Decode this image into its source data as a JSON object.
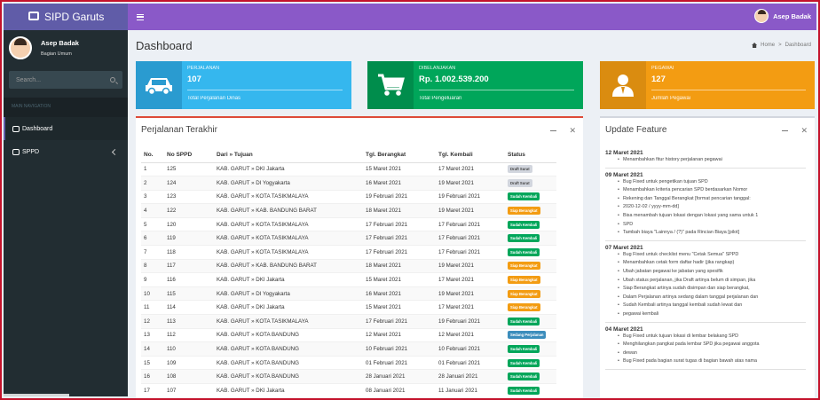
{
  "app": {
    "title": "SIPD Garuts"
  },
  "navbar": {
    "user_name": "Asep Badak"
  },
  "sidebar": {
    "user_name": "Asep Badak",
    "user_role": "Bagian Umum",
    "search_placeholder": "Search...",
    "header": "MAIN NAVIGATION",
    "items": [
      {
        "label": "Dashboard",
        "icon": "dashboard-icon"
      },
      {
        "label": "SPPD",
        "icon": "bus-icon"
      }
    ]
  },
  "page": {
    "title": "Dashboard",
    "breadcrumb": [
      "Home",
      "Dashboard"
    ]
  },
  "info_boxes": [
    {
      "label": "PERJALANAN",
      "value": "107",
      "desc": "Total Perjalanan Dinas",
      "icon": "car-icon",
      "color": "#35b7ee"
    },
    {
      "label": "DIBELANJAKAN",
      "value": "Rp. 1.002.539.200",
      "desc": "Total Pengeluaran",
      "icon": "cart-icon",
      "color": "#00a65a"
    },
    {
      "label": "PEGAWAI",
      "value": "127",
      "desc": "Jumlah Pegawai",
      "icon": "user-icon",
      "color": "#f39c12"
    }
  ],
  "trips": {
    "title": "Perjalanan Terakhir",
    "columns": [
      "No.",
      "No SPPD",
      "Dari » Tujuan",
      "Tgl. Berangkat",
      "Tgl. Kembali",
      "Status"
    ],
    "rows": [
      [
        "1",
        "125",
        "KAB. GARUT » DKI Jakarta",
        "15 Maret 2021",
        "17 Maret 2021",
        "Draft Surat",
        "draft"
      ],
      [
        "2",
        "124",
        "KAB. GARUT » DI Yogyakarta",
        "16 Maret 2021",
        "19 Maret 2021",
        "Draft Surat",
        "draft"
      ],
      [
        "3",
        "123",
        "KAB. GARUT » KOTA TASIKMALAYA",
        "19 Februari 2021",
        "19 Februari 2021",
        "Sudah Kembali",
        "sudah"
      ],
      [
        "4",
        "122",
        "KAB. GARUT » KAB. BANDUNG BARAT",
        "18 Maret 2021",
        "19 Maret 2021",
        "Siap Berangkat",
        "siap"
      ],
      [
        "5",
        "120",
        "KAB. GARUT » KOTA TASIKMALAYA",
        "17 Februari 2021",
        "17 Februari 2021",
        "Sudah Kembali",
        "sudah"
      ],
      [
        "6",
        "119",
        "KAB. GARUT » KOTA TASIKMALAYA",
        "17 Februari 2021",
        "17 Februari 2021",
        "Sudah Kembali",
        "sudah"
      ],
      [
        "7",
        "118",
        "KAB. GARUT » KOTA TASIKMALAYA",
        "17 Februari 2021",
        "17 Februari 2021",
        "Sudah Kembali",
        "sudah"
      ],
      [
        "8",
        "117",
        "KAB. GARUT » KAB. BANDUNG BARAT",
        "18 Maret 2021",
        "19 Maret 2021",
        "Siap Berangkat",
        "siap"
      ],
      [
        "9",
        "116",
        "KAB. GARUT » DKI Jakarta",
        "15 Maret 2021",
        "17 Maret 2021",
        "Siap Berangkat",
        "siap"
      ],
      [
        "10",
        "115",
        "KAB. GARUT » DI Yogyakarta",
        "16 Maret 2021",
        "19 Maret 2021",
        "Siap Berangkat",
        "siap"
      ],
      [
        "11",
        "114",
        "KAB. GARUT » DKI Jakarta",
        "15 Maret 2021",
        "17 Maret 2021",
        "Siap Berangkat",
        "siap"
      ],
      [
        "12",
        "113",
        "KAB. GARUT » KOTA TASIKMALAYA",
        "17 Februari 2021",
        "19 Februari 2021",
        "Sudah Kembali",
        "sudah"
      ],
      [
        "13",
        "112",
        "KAB. GARUT » KOTA BANDUNG",
        "12 Maret 2021",
        "12 Maret 2021",
        "Sedang Perjalanan",
        "sedang"
      ],
      [
        "14",
        "110",
        "KAB. GARUT » KOTA BANDUNG",
        "10 Februari 2021",
        "10 Februari 2021",
        "Sudah Kembali",
        "sudah"
      ],
      [
        "15",
        "109",
        "KAB. GARUT » KOTA BANDUNG",
        "01 Februari 2021",
        "01 Februari 2021",
        "Sudah Kembali",
        "sudah"
      ],
      [
        "16",
        "108",
        "KAB. GARUT » KOTA BANDUNG",
        "28 Januari 2021",
        "28 Januari 2021",
        "Sudah Kembali",
        "sudah"
      ],
      [
        "17",
        "107",
        "KAB. GARUT » DKI Jakarta",
        "08 Januari 2021",
        "11 Januari 2021",
        "Sudah Kembali",
        "sudah"
      ]
    ]
  },
  "updates": {
    "title": "Update Feature",
    "groups": [
      {
        "date": "12 Maret 2021",
        "items": [
          "Menambahkan fitur history perjalanan pegawai"
        ]
      },
      {
        "date": "09 Maret 2021",
        "items": [
          "Bug Fixed untuk pengetikan tujuan SPD",
          "Menambahkan kriteria pencarian SPD berdasarkan Nomor",
          "Rekening dan Tanggal Berangkat [format pencarian tanggal:",
          "2020-12-02 / yyyy-mm-dd]",
          "Bisa menambah tujuan lokasi dengan lokasi yang sama untuk 1",
          "SPD",
          "Tambah biaya \"Lainnya / (?)\" pada Rincian Biaya [pilot]"
        ]
      },
      {
        "date": "07 Maret 2021",
        "items": [
          "Bug Fixed untuk checklist menu \"Cetak Semua\" SPPD",
          "Menambahkan cetak form daftar hadir (jika rangkap)",
          "Ubah jabatan pegawai ke jabatan yang spesifik",
          "Ubah status perjalanan, jika Draft artinya belum di simpan, jika",
          "Siap Berangkat artinya sudah disimpan dan siap berangkat,",
          "Dalam Perjalanan artinya sedang dalam tanggal perjalanan dan",
          "Sudah Kembali artinya tanggal kembali sudah lewat dan",
          "pegawai kembali"
        ]
      },
      {
        "date": "04 Maret 2021",
        "items": [
          "Bug Fixed untuk tujuan lokasi di lembar belakang SPD",
          "Menghilangkan pangkat pada lembar SPD jika pegawai anggota",
          "dewan",
          "Bug Fixed pada bagian surat tugas di bagian bawah atas nama"
        ]
      }
    ]
  }
}
